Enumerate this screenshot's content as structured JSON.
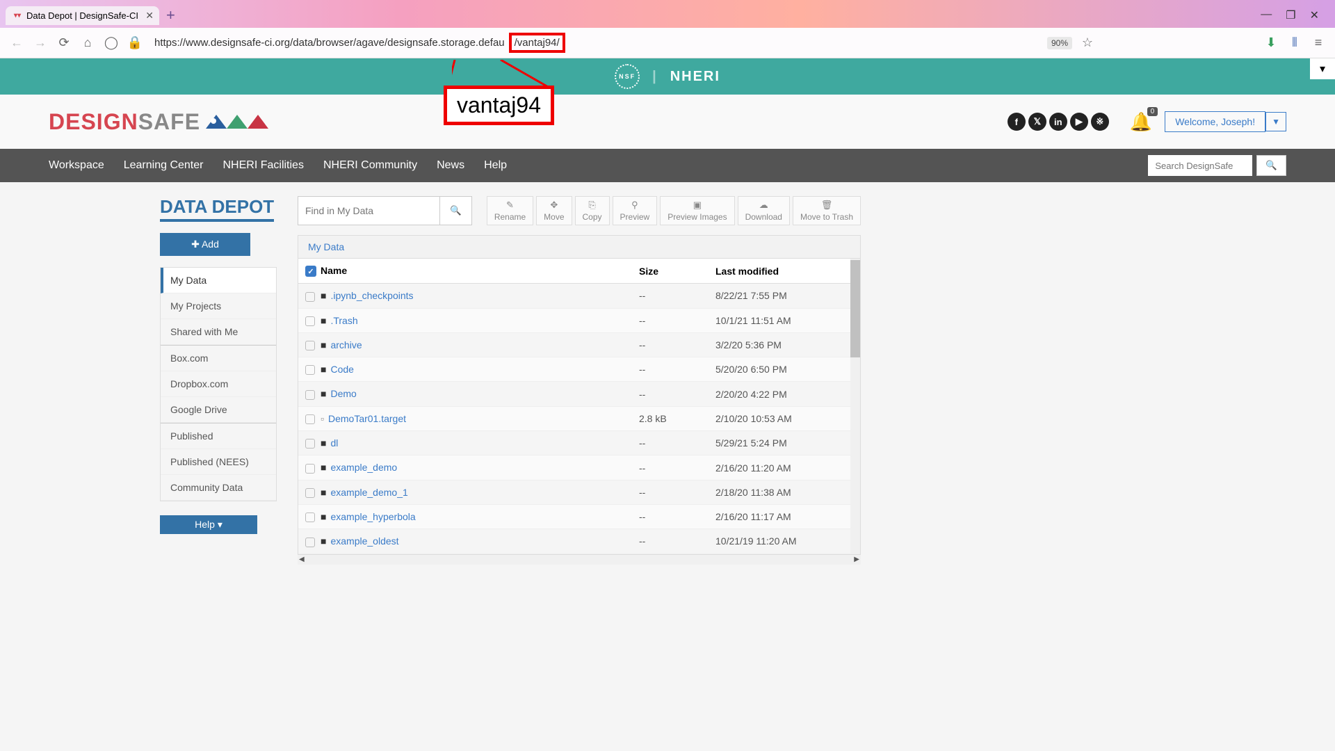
{
  "browser": {
    "tab_title": "Data Depot | DesignSafe-CI",
    "url": "https://www.designsafe-ci.org/data/browser/agave/designsafe.storage.defau",
    "url_highlighted": "/vantaj94/",
    "zoom": "90%"
  },
  "callout": {
    "text": "vantaj94"
  },
  "header": {
    "nheri": "NHERI",
    "nsf": "NSF",
    "logo_design": "DESIGN",
    "logo_safe": "SAFE",
    "notif_count": "0",
    "welcome": "Welcome, Joseph!"
  },
  "nav": {
    "items": [
      "Workspace",
      "Learning Center",
      "NHERI Facilities",
      "NHERI Community",
      "News",
      "Help"
    ],
    "search_placeholder": "Search DesignSafe"
  },
  "sidebar": {
    "title": "DATA DEPOT",
    "add_label": "Add",
    "items": [
      "My Data",
      "My Projects",
      "Shared with Me",
      "Box.com",
      "Dropbox.com",
      "Google Drive",
      "Published",
      "Published (NEES)",
      "Community Data"
    ],
    "help_label": "Help"
  },
  "toolbar": {
    "find_placeholder": "Find in My Data",
    "actions": [
      {
        "icon": "✎",
        "label": "Rename"
      },
      {
        "icon": "✥",
        "label": "Move"
      },
      {
        "icon": "⎘",
        "label": "Copy"
      },
      {
        "icon": "⚲",
        "label": "Preview"
      },
      {
        "icon": "▣",
        "label": "Preview Images"
      },
      {
        "icon": "☁",
        "label": "Download"
      },
      {
        "icon": "🗑",
        "label": "Move to Trash"
      }
    ]
  },
  "breadcrumb": "My Data",
  "table": {
    "headers": [
      "Name",
      "Size",
      "Last modified"
    ],
    "rows": [
      {
        "type": "folder",
        "name": ".ipynb_checkpoints",
        "size": "--",
        "modified": "8/22/21 7:55 PM"
      },
      {
        "type": "folder",
        "name": ".Trash",
        "size": "--",
        "modified": "10/1/21 11:51 AM"
      },
      {
        "type": "folder",
        "name": "archive",
        "size": "--",
        "modified": "3/2/20 5:36 PM"
      },
      {
        "type": "folder",
        "name": "Code",
        "size": "--",
        "modified": "5/20/20 6:50 PM"
      },
      {
        "type": "folder",
        "name": "Demo",
        "size": "--",
        "modified": "2/20/20 4:22 PM"
      },
      {
        "type": "file",
        "name": "DemoTar01.target",
        "size": "2.8 kB",
        "modified": "2/10/20 10:53 AM"
      },
      {
        "type": "folder",
        "name": "dl",
        "size": "--",
        "modified": "5/29/21 5:24 PM"
      },
      {
        "type": "folder",
        "name": "example_demo",
        "size": "--",
        "modified": "2/16/20 11:20 AM"
      },
      {
        "type": "folder",
        "name": "example_demo_1",
        "size": "--",
        "modified": "2/18/20 11:38 AM"
      },
      {
        "type": "folder",
        "name": "example_hyperbola",
        "size": "--",
        "modified": "2/16/20 11:17 AM"
      },
      {
        "type": "folder",
        "name": "example_oldest",
        "size": "--",
        "modified": "10/21/19 11:20 AM"
      }
    ]
  }
}
